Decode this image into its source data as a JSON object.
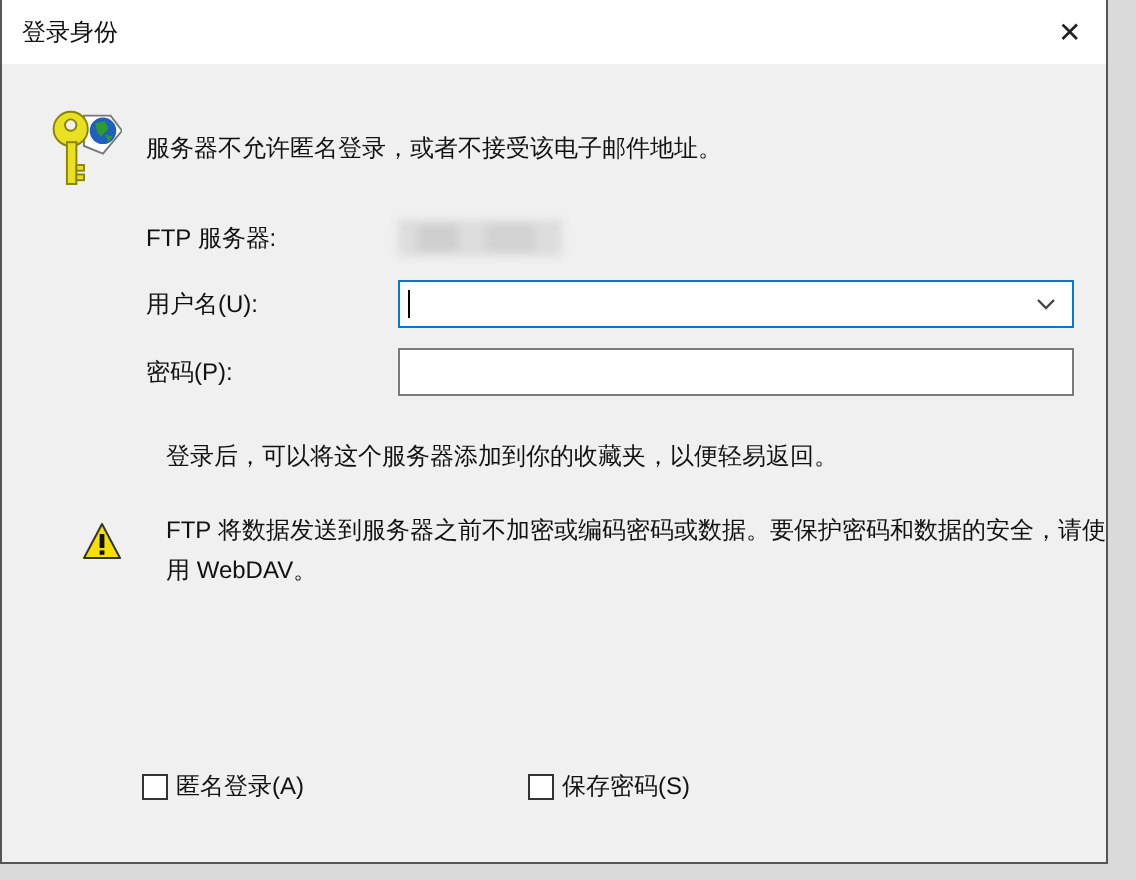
{
  "window": {
    "title": "登录身份",
    "close": "✕"
  },
  "message": "服务器不允许匿名登录，或者不接受该电子邮件地址。",
  "server": {
    "label": "FTP 服务器:"
  },
  "username": {
    "label": "用户名(U):",
    "focused": true
  },
  "password": {
    "label": "密码(P):"
  },
  "info": "登录后，可以将这个服务器添加到你的收藏夹，以便轻易返回。",
  "warning": "FTP 将数据发送到服务器之前不加密或编码密码或数据。要保护密码和数据的安全，请使用 WebDAV。",
  "checkboxes": [
    {
      "label": "匿名登录(A)",
      "checked": false
    },
    {
      "label": "保存密码(S)",
      "checked": false
    }
  ]
}
